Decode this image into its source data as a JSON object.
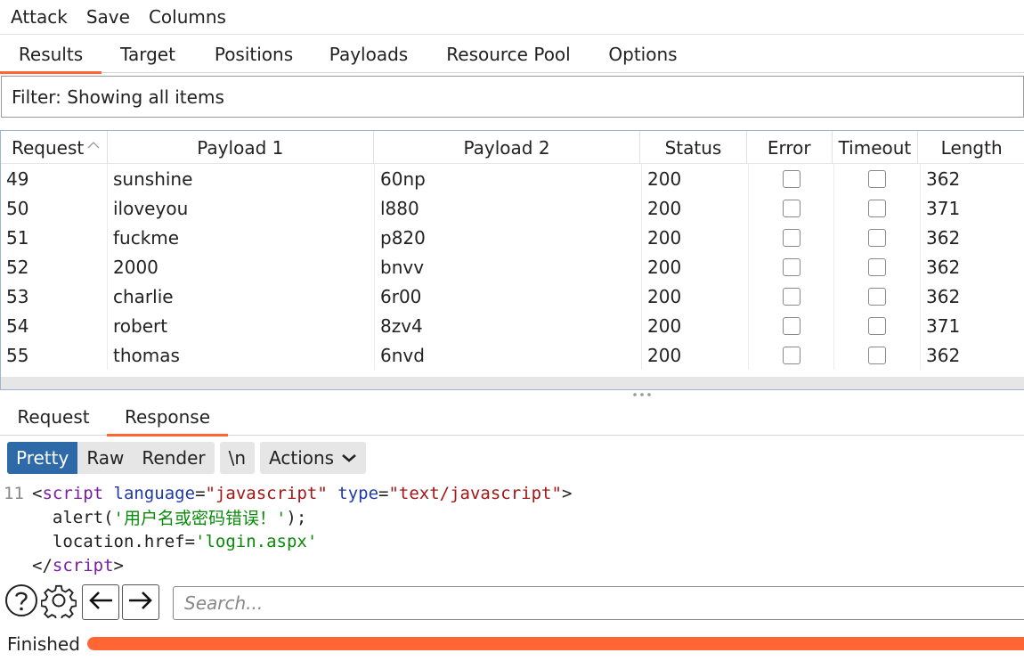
{
  "menu": [
    "Attack",
    "Save",
    "Columns"
  ],
  "top_tabs": [
    "Results",
    "Target",
    "Positions",
    "Payloads",
    "Resource Pool",
    "Options"
  ],
  "filter_text": "Filter: Showing all items",
  "table": {
    "headers": [
      "Request",
      "Payload 1",
      "Payload 2",
      "Status",
      "Error",
      "Timeout",
      "Length"
    ],
    "rows": [
      [
        "49",
        "sunshine",
        "60np",
        "200",
        "362"
      ],
      [
        "50",
        "iloveyou",
        "l880",
        "200",
        "371"
      ],
      [
        "51",
        "fuckme",
        "p820",
        "200",
        "362"
      ],
      [
        "52",
        "2000",
        "bnvv",
        "200",
        "362"
      ],
      [
        "53",
        "charlie",
        "6r00",
        "200",
        "362"
      ],
      [
        "54",
        "robert",
        "8zv4",
        "200",
        "371"
      ],
      [
        "55",
        "thomas",
        "6nvd",
        "200",
        "362"
      ]
    ]
  },
  "bottom_tabs": [
    "Request",
    "Response"
  ],
  "toolbar": {
    "view_buttons": [
      "Pretty",
      "Raw",
      "Render"
    ],
    "newline_button": "\\n",
    "actions_button": "Actions"
  },
  "code": {
    "line_number": "11",
    "l1_open": "<",
    "l1_tag": "script",
    "l1_attr1": "language",
    "l1_eq1": "=",
    "l1_val1": "\"javascript\"",
    "l1_attr2": "type",
    "l1_eq2": "=",
    "l1_val2": "\"text/javascript\"",
    "l1_close": ">",
    "l2_pre": "alert(",
    "l2_str": "'用户名或密码错误！'",
    "l2_post": ");",
    "l3_pre": "location.href=",
    "l3_str": "'login.aspx'",
    "l4_open": "</",
    "l4_tag": "script",
    "l4_close": ">"
  },
  "search": {
    "placeholder": "Search..."
  },
  "status": {
    "text": "Finished",
    "progress": 1.0
  },
  "colors": {
    "accent": "#ff6633",
    "active_button": "#2f6aa8"
  },
  "icons": [
    "help-icon",
    "gear-icon",
    "arrow-left-icon",
    "arrow-right-icon",
    "chevron-down-icon",
    "sort-up-icon"
  ]
}
